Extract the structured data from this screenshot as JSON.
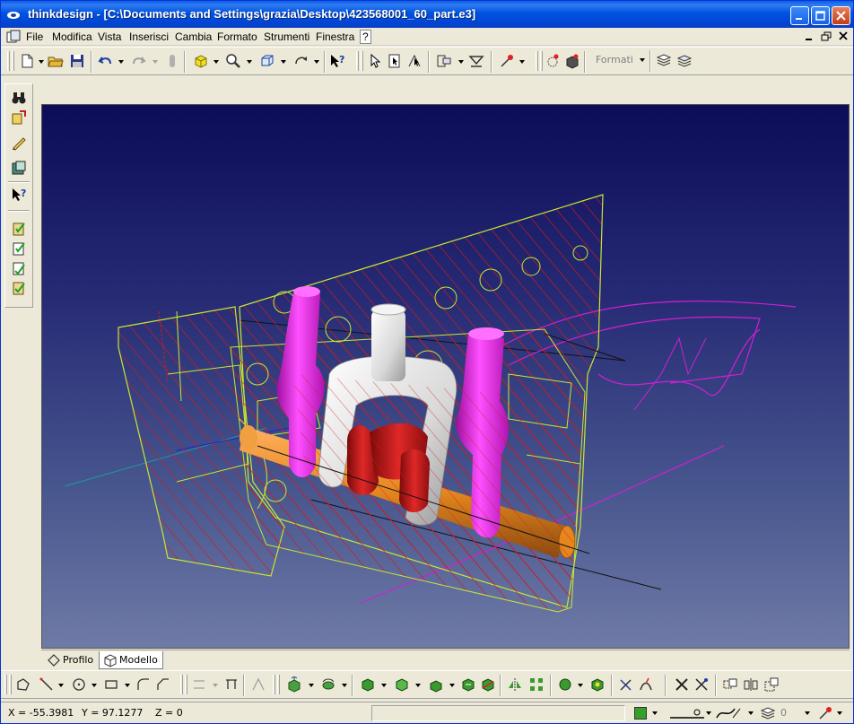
{
  "window": {
    "title": "thinkdesign  - [C:\\Documents and Settings\\grazia\\Desktop\\423568001_60_part.e3]"
  },
  "menu": {
    "items": [
      "File",
      "Modifica",
      "Vista",
      "Inserisci",
      "Cambia",
      "Formato",
      "Strumenti",
      "Finestra",
      "?"
    ]
  },
  "toolbar": {
    "style_combo_value": "Formati"
  },
  "tabs": [
    {
      "label": "Profilo",
      "active": false
    },
    {
      "label": "Modello",
      "active": true
    }
  ],
  "status": {
    "x": "X = -55.3981",
    "y": "Y = 97.1277",
    "z": "Z = 0",
    "layer": "0",
    "current_color": "#35a02a"
  },
  "colors": {
    "title_bar": "#0053e0",
    "viewport_top": "#0c0c58",
    "viewport_bottom": "#6f7aa6",
    "section_hatch": "#d21a1a",
    "profile_lines": "#c8e632",
    "forged_part": "#e31ee3",
    "shaft": "#e5861e",
    "fork": "#e8e8e8",
    "ring_part": "#c01818"
  }
}
